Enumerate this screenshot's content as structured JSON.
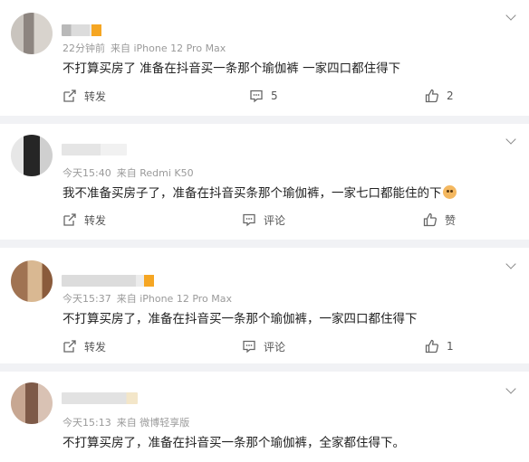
{
  "actions": {
    "repost_label": "转发",
    "comment_label": "评论",
    "like_label": "赞"
  },
  "comments": [
    {
      "time": "22分钟前",
      "source": "来自 iPhone 12 Pro Max",
      "text": "不打算买房了 准备在抖音买一条那个瑜伽裤 一家四口都住得下",
      "repost": "转发",
      "comment": "5",
      "like": "2"
    },
    {
      "time": "今天15:40",
      "source": "来自 Redmi K50",
      "text": "我不准备买房子了，准备在抖音买条那个瑜伽裤，一家七口都能住的下",
      "repost": "转发",
      "comment": "评论",
      "like": "赞"
    },
    {
      "time": "今天15:37",
      "source": "来自 iPhone 12 Pro Max",
      "text": "不打算买房了，准备在抖音买一条那个瑜伽裤，一家四口都住得下",
      "repost": "转发",
      "comment": "评论",
      "like": "1"
    },
    {
      "time": "今天15:13",
      "source": "来自 微博轻享版",
      "text": "不打算买房了，准备在抖音买一条那个瑜伽裤，全家都住得下。"
    }
  ]
}
